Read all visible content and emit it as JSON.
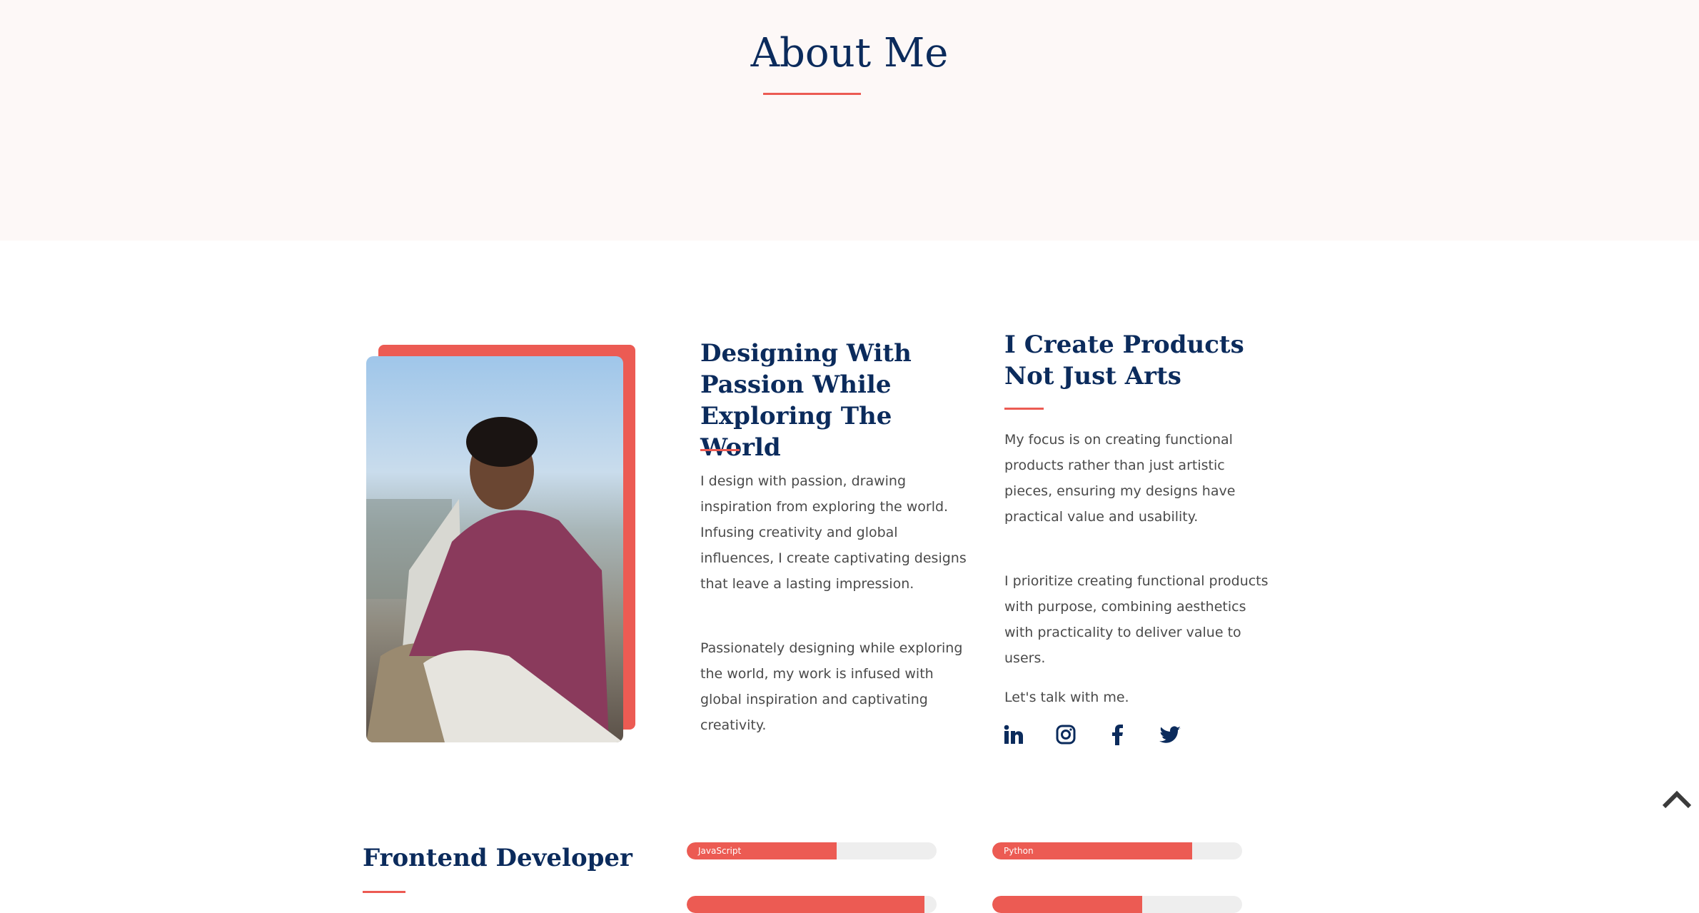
{
  "header": {
    "title": "About Me"
  },
  "col1": {
    "heading": "Designing With Passion While Exploring The World",
    "p1": "I design with passion, drawing inspiration from exploring the world. Infusing creativity and global influences, I create captivating designs that leave a lasting impression.",
    "p2": "Passionately designing while exploring the world, my work is infused with global inspiration and captivating creativity."
  },
  "col2": {
    "heading": "I Create Products Not Just Arts",
    "p1": "My focus is on creating functional products rather than just artistic pieces, ensuring my designs have practical value and usability.",
    "p2": "I prioritize creating functional products with purpose, combining aesthetics with practicality to deliver value to users.",
    "talk": "Let's talk with me."
  },
  "social": [
    "linkedin-icon",
    "instagram-icon",
    "facebook-icon",
    "twitter-icon"
  ],
  "skills": {
    "heading": "Frontend Developer",
    "bars": [
      {
        "label": "JavaScript",
        "percent": 60
      },
      {
        "label": "Python",
        "percent": 80
      },
      {
        "label": "",
        "percent": 95
      },
      {
        "label": "",
        "percent": 60
      }
    ]
  },
  "colors": {
    "navy": "#0b2b5c",
    "accent": "#ec5b53"
  }
}
